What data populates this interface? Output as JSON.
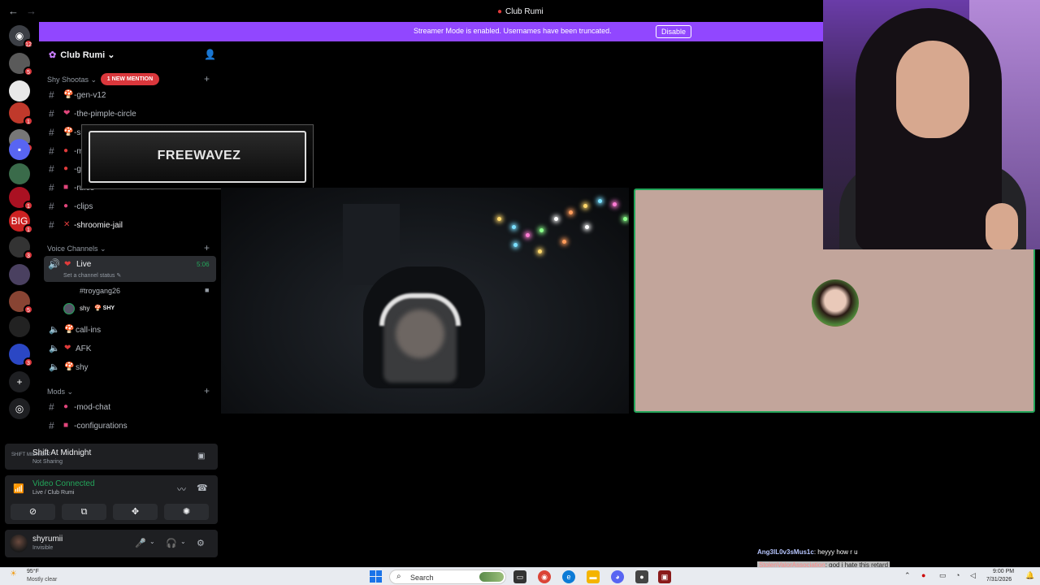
{
  "window": {
    "title": "Club Rumi",
    "back_icon": "←",
    "forward_icon": "→"
  },
  "banner": {
    "message": "Streamer Mode is enabled. Usernames have been truncated.",
    "button": "Disable"
  },
  "guild_rail": {
    "servers": [
      {
        "name": "direct-messages",
        "badge": "12",
        "color": "#3c3f45",
        "glyph": "◉"
      },
      {
        "name": "server-2",
        "badge": "5",
        "color": "#5a5a5a",
        "glyph": ""
      },
      {
        "name": "server-3",
        "badge": "",
        "color": "#e8e8e8",
        "glyph": ""
      },
      {
        "name": "server-club-rumi",
        "badge": "1",
        "color": "#c0392b",
        "glyph": ""
      },
      {
        "name": "server-5",
        "badge": "1",
        "color": "#777",
        "glyph": ""
      },
      {
        "name": "server-6",
        "badge": "",
        "color": "#5865f2",
        "glyph": "▪"
      },
      {
        "name": "server-7",
        "badge": "",
        "color": "#3a6b4a",
        "glyph": ""
      },
      {
        "name": "server-8",
        "badge": "1",
        "color": "#a12",
        "glyph": ""
      },
      {
        "name": "server-big5",
        "badge": "1",
        "color": "#c22",
        "glyph": "BIG"
      },
      {
        "name": "server-10",
        "badge": "3",
        "color": "#333",
        "glyph": ""
      },
      {
        "name": "server-11",
        "badge": "",
        "color": "#4a4060",
        "glyph": ""
      },
      {
        "name": "server-12",
        "badge": "5",
        "color": "#884433",
        "glyph": ""
      },
      {
        "name": "server-13",
        "badge": "",
        "color": "#222",
        "glyph": ""
      },
      {
        "name": "server-daily",
        "badge": "3",
        "color": "#2b47c4",
        "glyph": ""
      },
      {
        "name": "add-server",
        "badge": "",
        "color": "#1e1f22",
        "glyph": "+"
      },
      {
        "name": "discover",
        "badge": "",
        "color": "#1e1f22",
        "glyph": "◎"
      }
    ]
  },
  "sidebar": {
    "guild_name": "Club Rumi",
    "invite_icon": "👤",
    "category1": {
      "name": "Shy Shootas",
      "mention": "1 NEW MENTION"
    },
    "text_channels": [
      {
        "name": "-gen-v12",
        "emoji": "🍄",
        "emoji_color": "#e03b3b"
      },
      {
        "name": "-the-pimple-circle",
        "emoji": "❤",
        "emoji_color": "#e0457b"
      },
      {
        "name": "-s",
        "emoji": "🍄",
        "emoji_color": "#e03b3b"
      },
      {
        "name": "-m",
        "emoji": "●",
        "emoji_color": "#e03b3b"
      },
      {
        "name": "-g",
        "emoji": "●",
        "emoji_color": "#e03b3b"
      },
      {
        "name": "-rules",
        "emoji": "■",
        "emoji_color": "#e0457b"
      },
      {
        "name": "-clips",
        "emoji": "●",
        "emoji_color": "#e0457b"
      },
      {
        "name": "-shroomie-jail",
        "emoji": "✕",
        "emoji_color": "#e03b3b"
      }
    ],
    "voice_category": "Voice Channels",
    "live_channel": {
      "name": "Live",
      "time": "5:06",
      "status": "Set a channel status ✎"
    },
    "voice_users": [
      {
        "name": "#troygang26"
      },
      {
        "name": "shy",
        "tag": "🍄 SHY"
      }
    ],
    "voice_channels": [
      {
        "name": "call-ins",
        "emoji": "🍄"
      },
      {
        "name": "AFK",
        "emoji": "❤"
      },
      {
        "name": "shy",
        "emoji": "🍄"
      }
    ],
    "mods_category": "Mods",
    "mod_channels": [
      {
        "name": "-mod-chat",
        "emoji": "●"
      },
      {
        "name": "-configurations",
        "emoji": "■"
      }
    ]
  },
  "overlay": {
    "text": "FREEWAVEZ"
  },
  "now_playing": {
    "title": "Shift At Midnight",
    "status": "Not Sharing",
    "art": "SHIFT MIDNIGHT"
  },
  "rtc": {
    "status": "Video Connected",
    "channel": "Live / Club Rumi",
    "buttons": [
      "camera-off",
      "screen-share",
      "activities",
      "soundboard"
    ],
    "button_glyphs": [
      "⊘",
      "⧉",
      "✥",
      "✺"
    ]
  },
  "user": {
    "name": "shyrumii",
    "status": "Invisible",
    "mic_icon": "🎤",
    "headset_icon": "🎧",
    "settings_icon": "⚙"
  },
  "chat": [
    {
      "user": "Ang3lL0v3sMus1c",
      "message": ": heyyy how r u"
    },
    {
      "user": "StolenValorAssociation",
      "message": ": god i hate this retard"
    }
  ],
  "taskbar": {
    "weather_temp": "95°F",
    "weather_cond": "Mostly clear",
    "search": "Search",
    "time": "9:00 PM",
    "date": "7/31/2026"
  }
}
